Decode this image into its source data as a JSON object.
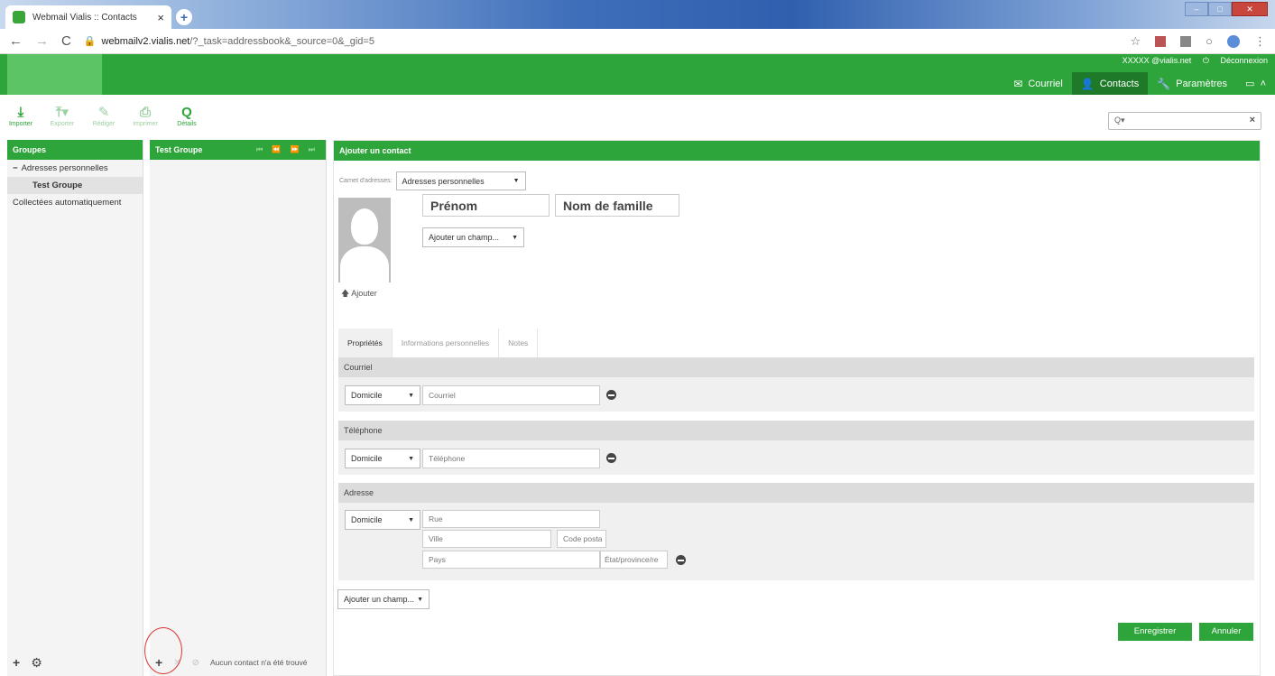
{
  "browser": {
    "tab_title": "Webmail Vialis :: Contacts",
    "tab_close": "×",
    "new_tab": "+",
    "url_host": "webmailv2.vialis.net",
    "url_path": "/?_task=addressbook&_source=0&_gid=5",
    "nav_back": "←",
    "nav_forward": "→",
    "reload": "C",
    "lock": "🔒",
    "star": "☆",
    "menu": "⋮"
  },
  "header": {
    "user": "XXXXX @vialis.net",
    "logout": "Déconnexion",
    "nav": [
      {
        "label": "Courriel",
        "icon": "envelope-icon"
      },
      {
        "label": "Contacts",
        "icon": "user-icon"
      },
      {
        "label": "Paramètres",
        "icon": "wrench-icon"
      }
    ]
  },
  "toolbar": {
    "import": "Importer",
    "export": "Exporter",
    "compose": "Rédiger",
    "print": "Imprimer",
    "details": "Détails"
  },
  "search": {
    "icon": "Q▾",
    "clear": "×"
  },
  "groups": {
    "title": "Groupes",
    "items": [
      "Adresses personnelles",
      "Test Groupe",
      "Collectées automatiquement"
    ]
  },
  "list": {
    "title": "Test Groupe",
    "pager": "⏮ ⏪ ⏩ ⏭",
    "empty": "Aucun contact n'a été trouvé"
  },
  "form": {
    "title": "Ajouter un contact",
    "carnet_label": "Carnet d'adresses:",
    "carnet_value": "Adresses personnelles",
    "firstname": "Prénom",
    "lastname": "Nom de famille",
    "add_field": "Ajouter un champ...",
    "add_photo": "Ajouter",
    "tabs": [
      "Propriétés",
      "Informations personnelles",
      "Notes"
    ],
    "email": {
      "title": "Courriel",
      "type": "Domicile",
      "placeholder": "Courriel"
    },
    "phone": {
      "title": "Téléphone",
      "type": "Domicile",
      "placeholder": "Téléphone"
    },
    "address": {
      "title": "Adresse",
      "type": "Domicile",
      "street": "Rue",
      "city": "Ville",
      "zip": "Code posta",
      "country": "Pays",
      "state": "État/province/re"
    },
    "add_field_bottom": "Ajouter un champ...",
    "save": "Enregistrer",
    "cancel": "Annuler"
  }
}
